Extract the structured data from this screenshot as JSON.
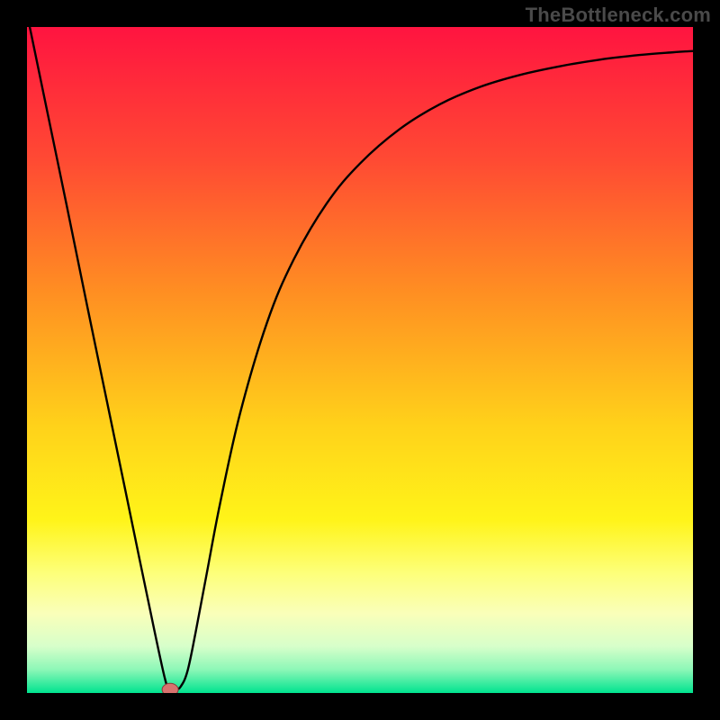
{
  "watermark": "TheBottleneck.com",
  "colors": {
    "frame": "#000000",
    "curve": "#000000",
    "marker_fill": "#d9726e",
    "marker_stroke": "#8a3e3b",
    "gradient_stops": [
      {
        "offset": 0.0,
        "color": "#ff1440"
      },
      {
        "offset": 0.2,
        "color": "#ff4a33"
      },
      {
        "offset": 0.4,
        "color": "#ff8f22"
      },
      {
        "offset": 0.6,
        "color": "#ffd21a"
      },
      {
        "offset": 0.74,
        "color": "#fff419"
      },
      {
        "offset": 0.82,
        "color": "#fdff7a"
      },
      {
        "offset": 0.88,
        "color": "#faffb9"
      },
      {
        "offset": 0.93,
        "color": "#d7ffca"
      },
      {
        "offset": 0.965,
        "color": "#8cf7b7"
      },
      {
        "offset": 1.0,
        "color": "#00e38f"
      }
    ]
  },
  "chart_data": {
    "type": "line",
    "title": "",
    "xlabel": "",
    "ylabel": "",
    "xlim": [
      0,
      1
    ],
    "ylim": [
      0,
      1
    ],
    "x": [
      0.0,
      0.03,
      0.06,
      0.09,
      0.12,
      0.15,
      0.18,
      0.207,
      0.215,
      0.223,
      0.231,
      0.241,
      0.253,
      0.27,
      0.29,
      0.32,
      0.36,
      0.4,
      0.45,
      0.5,
      0.56,
      0.62,
      0.68,
      0.74,
      0.8,
      0.86,
      0.92,
      0.97,
      1.0
    ],
    "values": [
      1.02,
      0.875,
      0.73,
      0.583,
      0.438,
      0.293,
      0.148,
      0.022,
      0.008,
      0.005,
      0.01,
      0.033,
      0.09,
      0.18,
      0.285,
      0.42,
      0.555,
      0.65,
      0.735,
      0.795,
      0.847,
      0.884,
      0.91,
      0.928,
      0.941,
      0.951,
      0.958,
      0.962,
      0.964
    ],
    "marker": {
      "x": 0.215,
      "y": 0.005
    }
  }
}
